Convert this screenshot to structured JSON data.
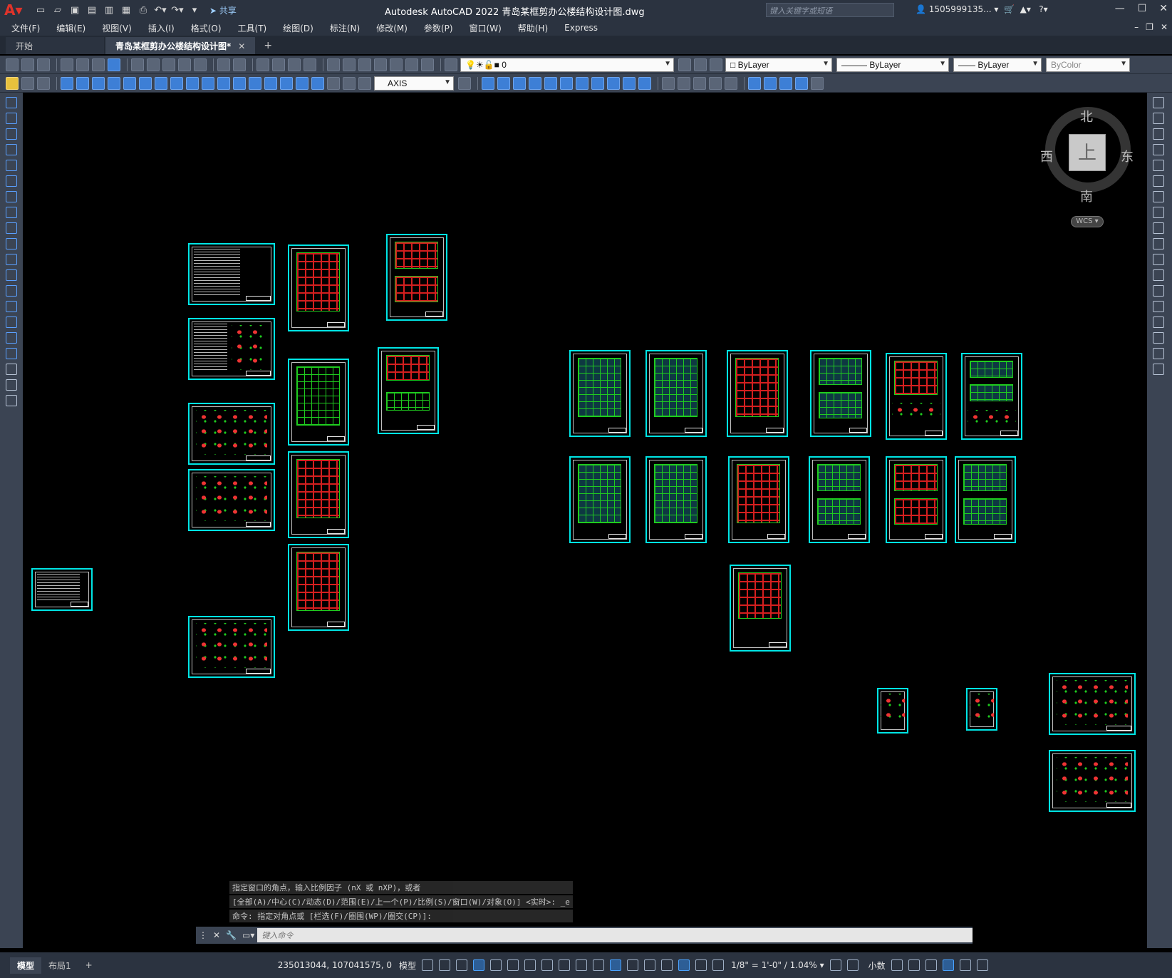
{
  "app": {
    "title": "Autodesk AutoCAD 2022    青岛某框剪办公楼结构设计图.dwg",
    "share_label": "共享",
    "search_placeholder": "键入关键字或短语",
    "user": "1505999135... ▾"
  },
  "menu": [
    "文件(F)",
    "编辑(E)",
    "视图(V)",
    "插入(I)",
    "格式(O)",
    "工具(T)",
    "绘图(D)",
    "标注(N)",
    "修改(M)",
    "参数(P)",
    "窗口(W)",
    "帮助(H)",
    "Express"
  ],
  "tabs": {
    "start": "开始",
    "active": "青岛某框剪办公楼结构设计图*",
    "close": "✕",
    "add": "+"
  },
  "toolbar": {
    "layer_value": "0",
    "color": "ByLayer",
    "linetype": "ByLayer",
    "lineweight": "ByLayer",
    "plotstyle": "ByColor",
    "textstyle": "AXIS"
  },
  "viewcube": {
    "north": "北",
    "south": "南",
    "east": "东",
    "west": "西",
    "face": "上",
    "wcs": "WCS ▾"
  },
  "command": {
    "history": [
      "指定窗口的角点，输入比例因子 (nX 或 nXP)，或者",
      "[全部(A)/中心(C)/动态(D)/范围(E)/上一个(P)/比例(S)/窗口(W)/对象(O)] <实时>: _e",
      "命令: 指定对角点或 [栏选(F)/圈围(WP)/圈交(CP)]:"
    ],
    "placeholder": "键入命令"
  },
  "status": {
    "model_tab": "模型",
    "layout_tab": "布局1",
    "add_tab": "+",
    "coordinates": "235013044, 107041575, 0",
    "space": "模型",
    "scale": "1/8\" = 1'-0\" / 1.04% ▾",
    "units": "小数"
  },
  "colors": {
    "sheet_border": "#00e5e5",
    "grid_green": "#1fcc1f",
    "grid_red": "#d41f1f",
    "chrome": "#3b4453"
  }
}
